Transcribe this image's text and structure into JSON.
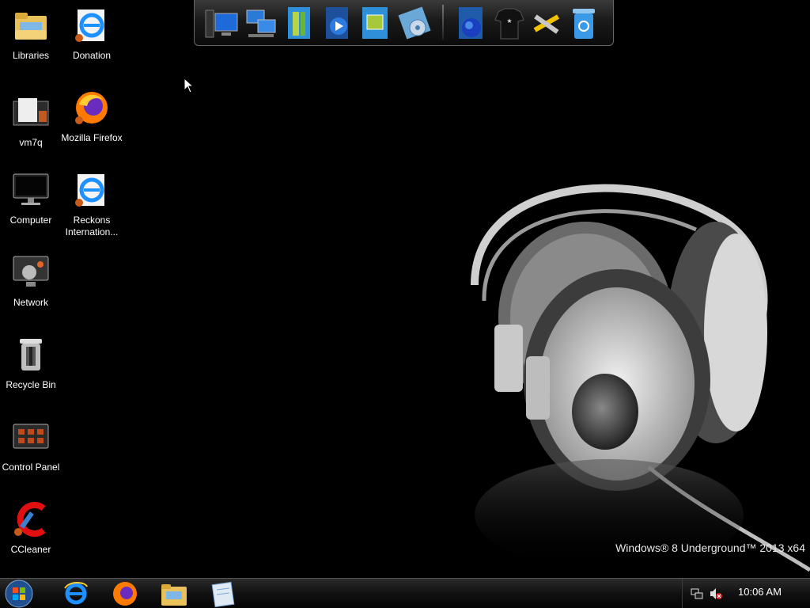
{
  "desktop": {
    "watermark": "Windows® 8 Underground™ 2013 x64",
    "icons": [
      {
        "label": "Libraries",
        "icon": "libraries-folder-icon"
      },
      {
        "label": "Donation",
        "icon": "internet-explorer-icon"
      },
      {
        "label": "vm7q",
        "icon": "document-folder-icon"
      },
      {
        "label": "Mozilla Firefox",
        "icon": "firefox-icon"
      },
      {
        "label": "Computer",
        "icon": "monitor-icon"
      },
      {
        "label": "Reckons Internation...",
        "icon": "internet-explorer-icon"
      },
      {
        "label": "Network",
        "icon": "network-icon"
      },
      {
        "label": "Recycle Bin",
        "icon": "recycle-bin-icon"
      },
      {
        "label": "Control Panel",
        "icon": "control-panel-icon"
      },
      {
        "label": "CCleaner",
        "icon": "ccleaner-icon"
      }
    ]
  },
  "dock": {
    "items": [
      "computer-icon",
      "network-computers-icon",
      "library-icon",
      "media-player-icon",
      "photo-gallery-icon",
      "disc-icon",
      "globe-icon",
      "tshirt-icon",
      "tools-icon",
      "recycle-bin-icon"
    ]
  },
  "taskbar": {
    "start": "start-orb-icon",
    "items": [
      "internet-explorer-icon",
      "firefox-icon",
      "file-explorer-icon",
      "notepad-icon"
    ],
    "tray": {
      "network": "network-tray-icon",
      "volume": "volume-muted-icon",
      "clock": "10:06 AM"
    }
  },
  "colors": {
    "background": "#000000",
    "taskbar": "#111111",
    "ie_blue": "#1e90ff",
    "firefox_orange": "#ff7a00"
  }
}
